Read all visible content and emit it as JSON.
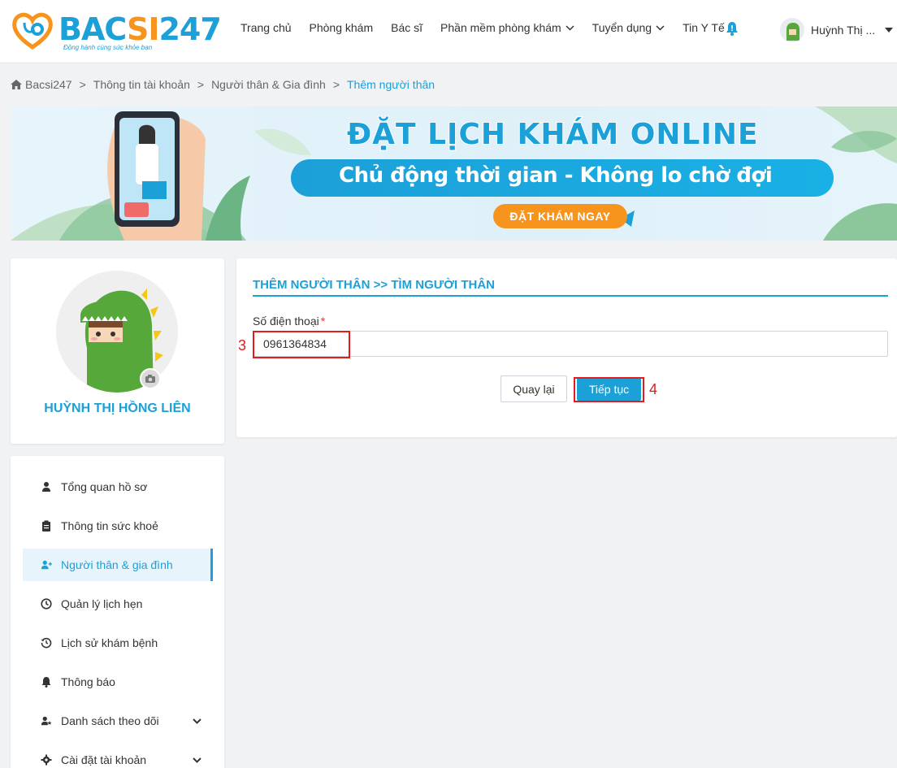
{
  "header": {
    "logo_text": "BACSI247",
    "logo_tagline": "Đồng hành cùng sức khỏe bạn",
    "nav": [
      {
        "label": "Trang chủ",
        "dropdown": false
      },
      {
        "label": "Phòng khám",
        "dropdown": false
      },
      {
        "label": "Bác sĩ",
        "dropdown": false
      },
      {
        "label": "Phần mềm phòng khám",
        "dropdown": true
      },
      {
        "label": "Tuyển dụng",
        "dropdown": true
      },
      {
        "label": "Tin Y Tế",
        "dropdown": false
      }
    ],
    "notification_icon": "bell-icon",
    "user_name": "Huỳnh Thị ..."
  },
  "breadcrumb": [
    "Bacsi247",
    "Thông tin tài khoản",
    "Người thân & Gia đình",
    "Thêm người thân"
  ],
  "banner": {
    "title": "ĐẶT LỊCH KHÁM ONLINE",
    "subtitle": "Chủ động thời gian - Không lo chờ đợi",
    "cta": "ĐẶT KHÁM NGAY"
  },
  "profile": {
    "name": "HUỲNH THỊ HỒNG LIÊN",
    "camera_icon": "camera-icon"
  },
  "menu": [
    {
      "label": "Tổng quan hồ sơ",
      "icon": "user-icon",
      "active": false,
      "chevron": false
    },
    {
      "label": "Thông tin sức khoẻ",
      "icon": "clipboard-icon",
      "active": false,
      "chevron": false
    },
    {
      "label": "Người thân & gia đình",
      "icon": "user-plus-icon",
      "active": true,
      "chevron": false
    },
    {
      "label": "Quản lý lịch hẹn",
      "icon": "clock-icon",
      "active": false,
      "chevron": false
    },
    {
      "label": "Lịch sử khám bệnh",
      "icon": "history-icon",
      "active": false,
      "chevron": false
    },
    {
      "label": "Thông báo",
      "icon": "bell-icon",
      "active": false,
      "chevron": false
    },
    {
      "label": "Danh sách theo dõi",
      "icon": "user-star-icon",
      "active": false,
      "chevron": true
    },
    {
      "label": "Cài đặt tài khoản",
      "icon": "gear-icon",
      "active": false,
      "chevron": true
    }
  ],
  "form": {
    "title": "THÊM NGƯỜI THÂN >> TÌM NGƯỜI THÂN",
    "phone_label": "Số điện thoại",
    "required_mark": "*",
    "phone_value": "0961364834",
    "back_label": "Quay lại",
    "next_label": "Tiếp tục"
  },
  "annotations": {
    "step_input": "3",
    "step_button": "4"
  },
  "colors": {
    "primary": "#1ca0d8",
    "accent": "#f7941d",
    "annotation": "#e21b1b"
  }
}
